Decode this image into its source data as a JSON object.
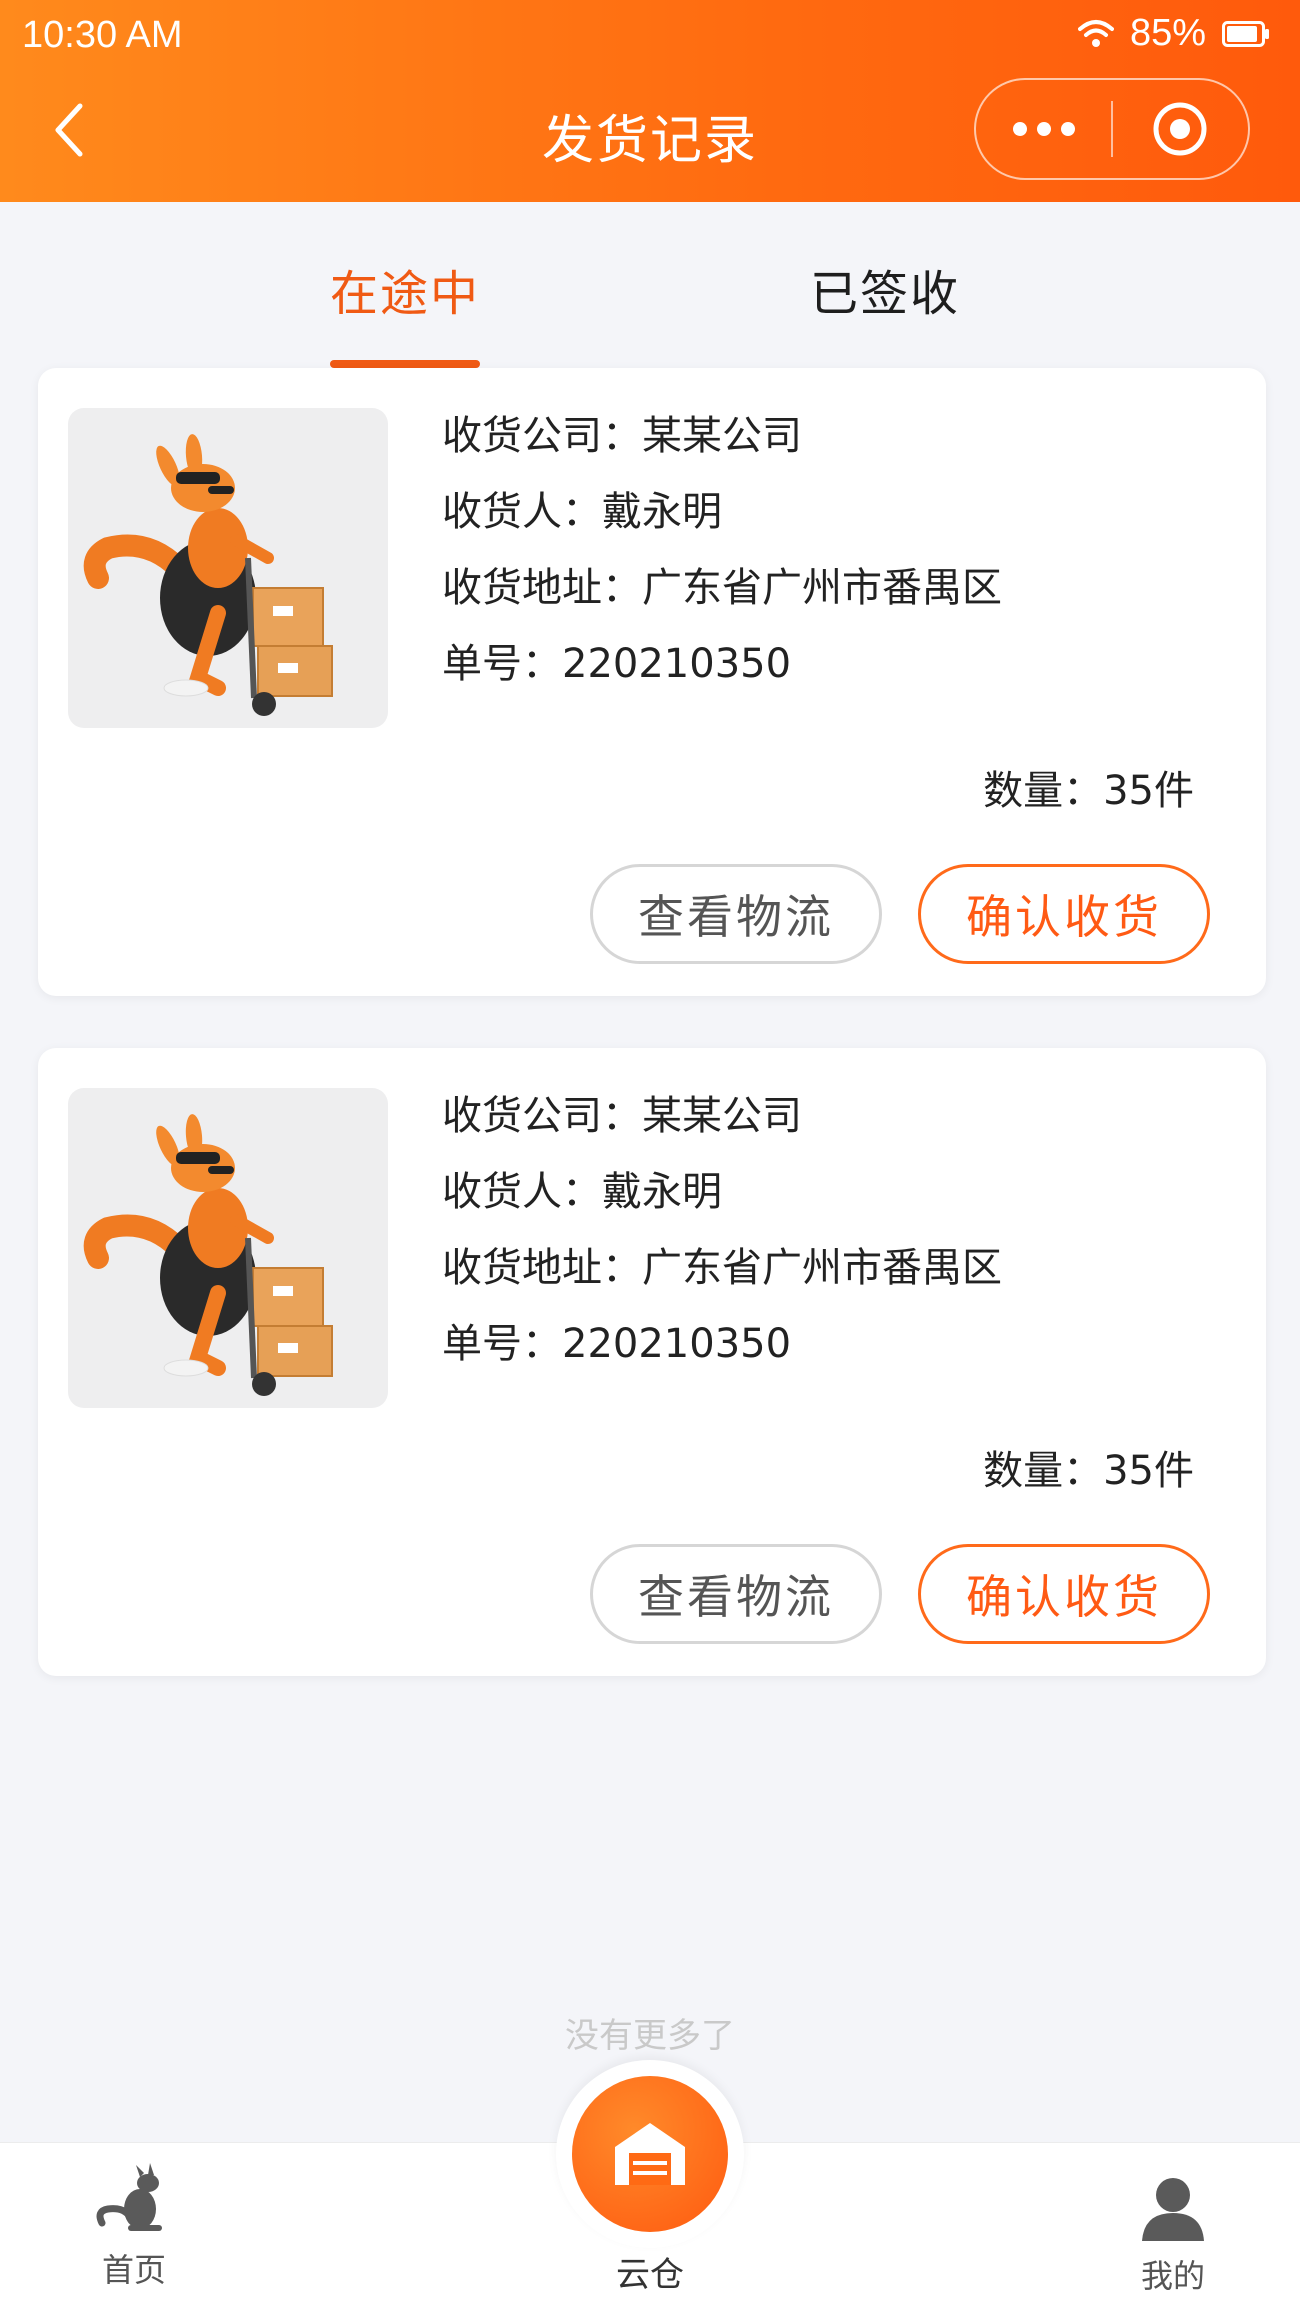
{
  "status_bar": {
    "time": "10:30 AM",
    "battery": "85%"
  },
  "header": {
    "title": "发货记录"
  },
  "tabs": [
    {
      "label": "在途中",
      "active": true
    },
    {
      "label": "已签收",
      "active": false
    }
  ],
  "orders": [
    {
      "company_label": "收货公司：",
      "company": "某某公司",
      "receiver_label": "收货人：",
      "receiver": "戴永明",
      "address_label": "收货地址：",
      "address": "广东省广州市番禺区",
      "number_label": "单号：",
      "number": "220210350",
      "qty_label": "数量：",
      "qty": "35件",
      "btn_logistics": "查看物流",
      "btn_confirm": "确认收货"
    },
    {
      "company_label": "收货公司：",
      "company": "某某公司",
      "receiver_label": "收货人：",
      "receiver": "戴永明",
      "address_label": "收货地址：",
      "address": "广东省广州市番禺区",
      "number_label": "单号：",
      "number": "220210350",
      "qty_label": "数量：",
      "qty": "35件",
      "btn_logistics": "查看物流",
      "btn_confirm": "确认收货"
    }
  ],
  "footer": {
    "no_more": "没有更多了"
  },
  "tabbar": {
    "home": "首页",
    "cloud": "云仓",
    "mine": "我的"
  },
  "colors": {
    "accent": "#f05a14",
    "header_start": "#ff8a1c",
    "header_end": "#ff5a0c",
    "background": "#f4f5f9"
  }
}
